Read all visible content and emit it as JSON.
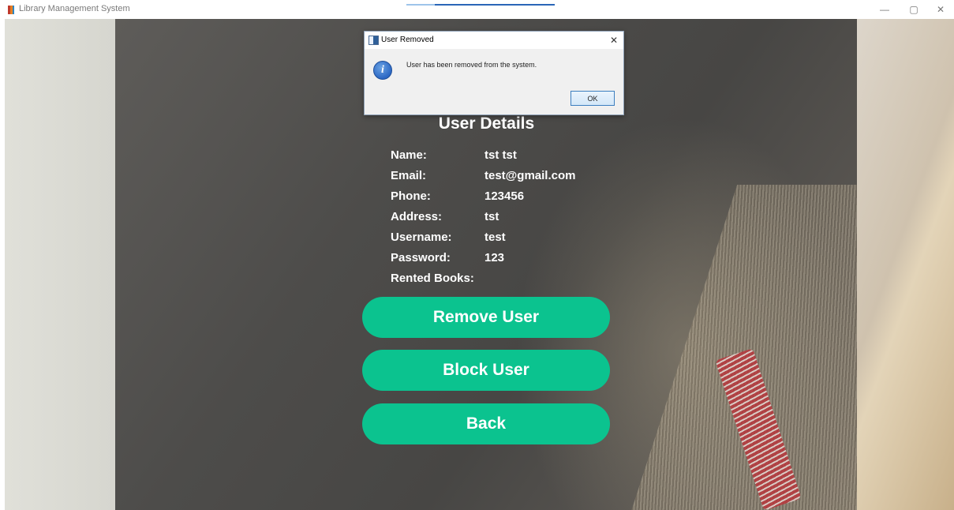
{
  "window": {
    "title": "Library Management System",
    "controls": {
      "minimize": "—",
      "maximize": "▢",
      "close": "✕"
    }
  },
  "user_details": {
    "title": "User Details",
    "fields": [
      {
        "label": "Name:",
        "value": "tst tst"
      },
      {
        "label": "Email:",
        "value": "test@gmail.com"
      },
      {
        "label": "Phone:",
        "value": "123456"
      },
      {
        "label": "Address:",
        "value": "tst"
      },
      {
        "label": "Username:",
        "value": "test"
      },
      {
        "label": "Password:",
        "value": "123"
      },
      {
        "label": "Rented Books:",
        "value": ""
      }
    ]
  },
  "actions": {
    "remove_label": "Remove User",
    "block_label": "Block User",
    "back_label": "Back"
  },
  "dialog": {
    "title": "User Removed",
    "close_glyph": "✕",
    "icon_glyph": "i",
    "message": "User has been removed from the system.",
    "ok_label": "OK"
  },
  "colors": {
    "button_green": "#0bc38f",
    "text_white": "#ffffff",
    "dialog_bg": "#f0f0f0",
    "info_blue": "#2c68c4"
  },
  "icons": {
    "app": "book-icon",
    "dialog": "window-app-icon",
    "info": "info-icon"
  }
}
